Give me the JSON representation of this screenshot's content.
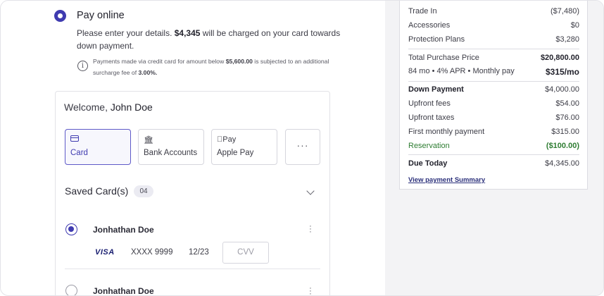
{
  "payment": {
    "option_label": "Pay online",
    "desc_before": "Please enter your details. ",
    "desc_amount": "$4,345",
    "desc_after": " will be charged on your card towards down payment.",
    "note_before": "Payments made via credit card for amount below ",
    "note_threshold": "$5,600.00",
    "note_middle": " is subjected to an additional surcharge fee of ",
    "note_fee": "3.00%."
  },
  "wallet": {
    "welcome_prefix": "Welcome, ",
    "user_name": "John Doe",
    "methods": [
      {
        "label": "Card",
        "icon": "card-icon",
        "active": true
      },
      {
        "label": "Bank Accounts",
        "icon": "bank-icon",
        "active": false
      },
      {
        "label": "Apple Pay",
        "icon": "apple-pay-icon",
        "icon_text": "Pay",
        "active": false
      },
      {
        "label": "···",
        "icon": "more-icon",
        "active": false
      }
    ],
    "saved_title": "Saved Card(s)",
    "saved_count": "04",
    "cards": [
      {
        "holder": "Jonhathan Doe",
        "brand": "VISA",
        "number": "XXXX 9999",
        "expiry": "12/23",
        "cvv_placeholder": "CVV",
        "selected": true
      },
      {
        "holder": "Jonhathan Doe",
        "selected": false
      }
    ]
  },
  "summary": {
    "rows_top": [
      {
        "label": "Trade In",
        "value": "($7,480)"
      },
      {
        "label": "Accessories",
        "value": "$0"
      },
      {
        "label": "Protection Plans",
        "value": "$3,280"
      }
    ],
    "total_label": "Total Purchase Price",
    "total_value": "$20,800.00",
    "term_label": "84 mo • 4% APR • Monthly pay",
    "term_value": "$315/mo",
    "down_label": "Down Payment",
    "down_value": "$4,000.00",
    "rows_mid": [
      {
        "label": "Upfront fees",
        "value": "$54.00"
      },
      {
        "label": "Upfront taxes",
        "value": "$76.00"
      },
      {
        "label": "First monthly payment",
        "value": "$315.00"
      }
    ],
    "reservation_label": "Reservation",
    "reservation_value": "($100.00)",
    "due_label": "Due Today",
    "due_value": "$4,345.00",
    "view_link": "View payment Summary"
  },
  "colors": {
    "accent": "#3f3bb0",
    "reservation": "#2e7d32",
    "panel_bg": "#f3f3f5"
  }
}
